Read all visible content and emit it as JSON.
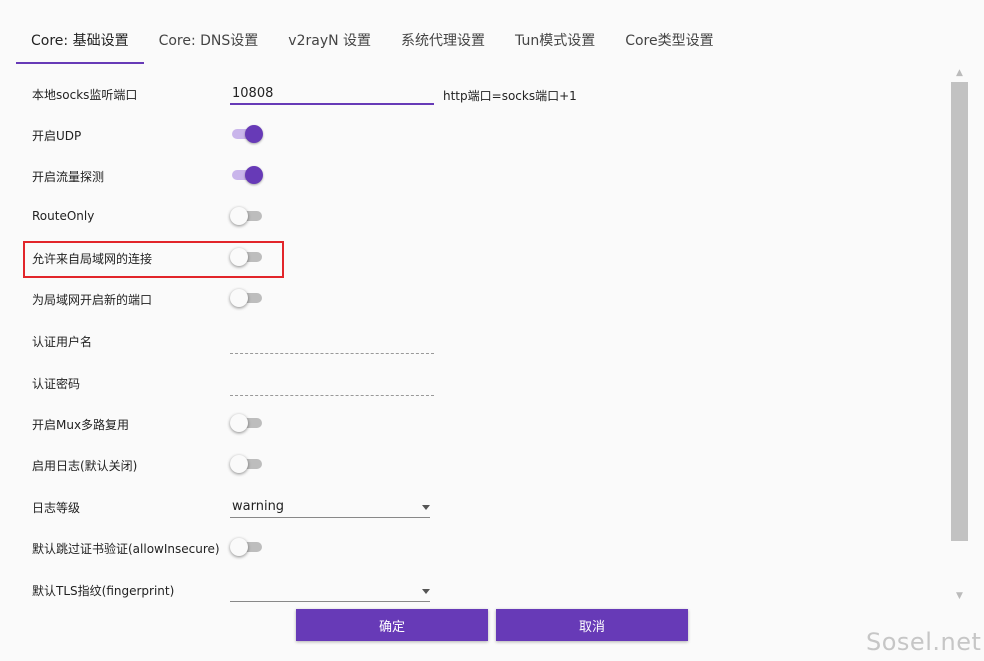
{
  "tabs": [
    {
      "label": "Core: 基础设置",
      "active": true
    },
    {
      "label": "Core: DNS设置",
      "active": false
    },
    {
      "label": "v2rayN 设置",
      "active": false
    },
    {
      "label": "系统代理设置",
      "active": false
    },
    {
      "label": "Tun模式设置",
      "active": false
    },
    {
      "label": "Core类型设置",
      "active": false
    }
  ],
  "settings": {
    "socks_port": {
      "label": "本地socks监听端口",
      "value": "10808",
      "hint": "http端口=socks端口+1"
    },
    "udp": {
      "label": "开启UDP",
      "on": true
    },
    "sniffing": {
      "label": "开启流量探测",
      "on": true
    },
    "route_only": {
      "label": "RouteOnly",
      "on": false
    },
    "allow_lan": {
      "label": "允许来自局域网的连接",
      "on": false
    },
    "new_lan_port": {
      "label": "为局域网开启新的端口",
      "on": false
    },
    "auth_user": {
      "label": "认证用户名",
      "value": ""
    },
    "auth_pass": {
      "label": "认证密码",
      "value": ""
    },
    "mux": {
      "label": "开启Mux多路复用",
      "on": false
    },
    "log": {
      "label": "启用日志(默认关闭)",
      "on": false
    },
    "log_level": {
      "label": "日志等级",
      "value": "warning"
    },
    "allow_insecure": {
      "label": "默认跳过证书验证(allowInsecure)",
      "on": false
    },
    "fingerprint": {
      "label": "默认TLS指纹(fingerprint)",
      "value": ""
    }
  },
  "buttons": {
    "ok": "确定",
    "cancel": "取消"
  },
  "scrollbar": {
    "up_icon": "arrow-up-icon",
    "down_icon": "arrow-down-icon"
  },
  "watermark": "Sosel.net",
  "colors": {
    "accent": "#673ab7",
    "highlight_border": "#e2252a"
  }
}
